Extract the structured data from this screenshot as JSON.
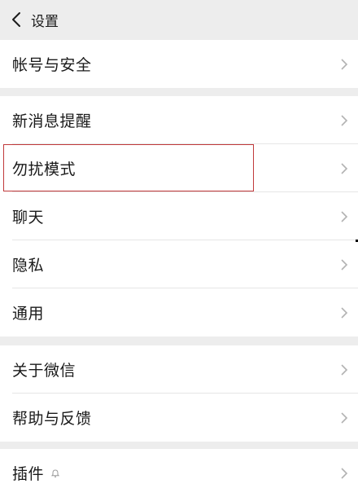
{
  "header": {
    "title": "设置"
  },
  "groups": [
    {
      "items": [
        {
          "label": "帐号与安全"
        }
      ]
    },
    {
      "items": [
        {
          "label": "新消息提醒"
        },
        {
          "label": "勿扰模式"
        },
        {
          "label": "聊天"
        },
        {
          "label": "隐私"
        },
        {
          "label": "通用"
        }
      ]
    },
    {
      "items": [
        {
          "label": "关于微信"
        },
        {
          "label": "帮助与反馈"
        }
      ]
    },
    {
      "items": [
        {
          "label": "插件"
        }
      ]
    }
  ],
  "icons": {
    "back": "chevron-left-icon",
    "row_arrow": "chevron-right-icon",
    "plugin_badge": "bell-badge-icon"
  },
  "colors": {
    "background": "#ededed",
    "card": "#ffffff",
    "highlight": "#c0393b",
    "chevron": "#b2b2b2"
  }
}
